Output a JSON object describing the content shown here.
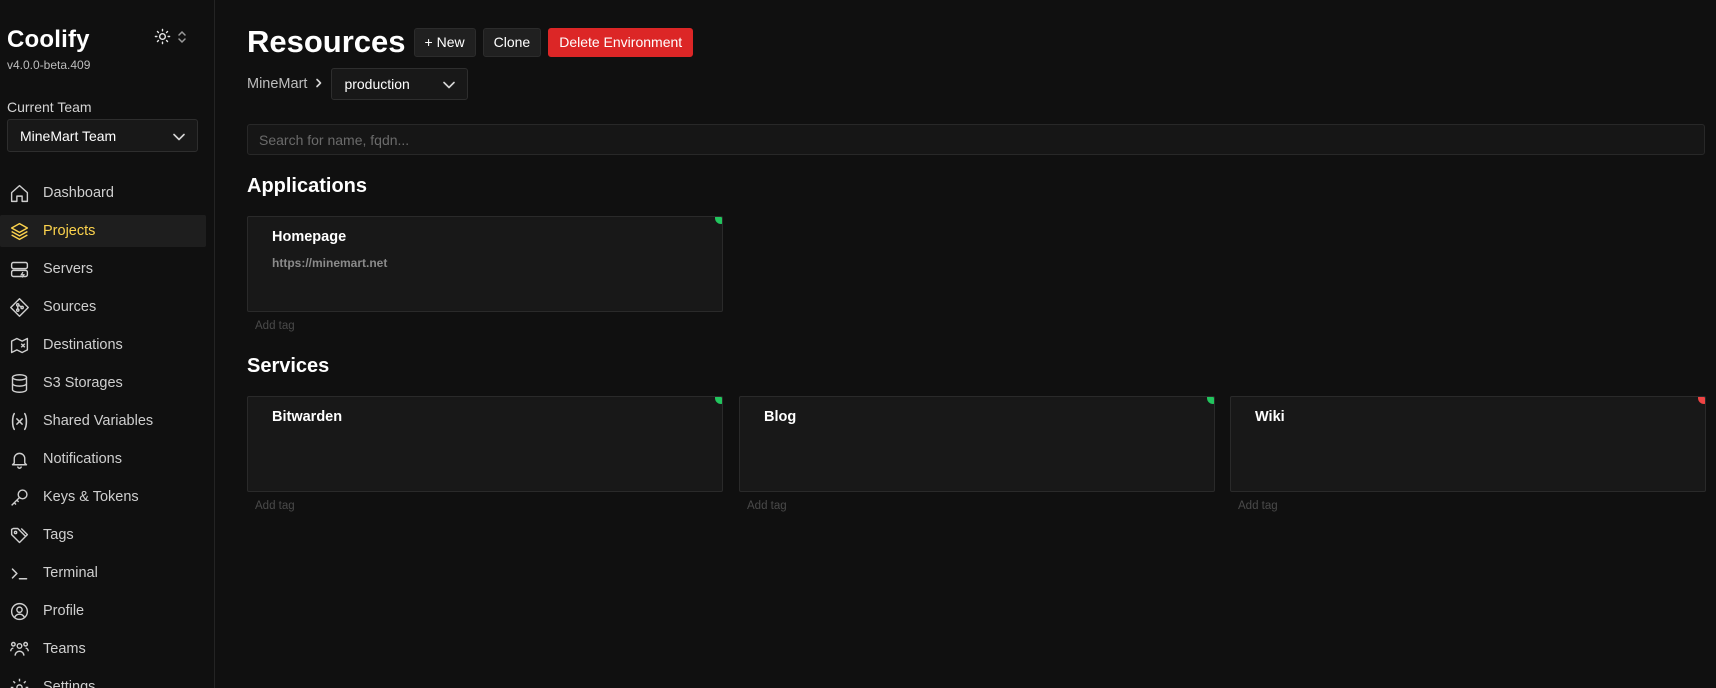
{
  "sidebar": {
    "brand": "Coolify",
    "version": "v4.0.0-beta.409",
    "team_label": "Current Team",
    "team_selected": "MineMart Team",
    "items": [
      {
        "label": "Dashboard",
        "icon": "home-icon"
      },
      {
        "label": "Projects",
        "icon": "layers-icon",
        "active": true
      },
      {
        "label": "Servers",
        "icon": "server-icon"
      },
      {
        "label": "Sources",
        "icon": "git-icon"
      },
      {
        "label": "Destinations",
        "icon": "destination-icon"
      },
      {
        "label": "S3 Storages",
        "icon": "database-icon"
      },
      {
        "label": "Shared Variables",
        "icon": "variable-icon"
      },
      {
        "label": "Notifications",
        "icon": "bell-icon"
      },
      {
        "label": "Keys & Tokens",
        "icon": "key-icon"
      },
      {
        "label": "Tags",
        "icon": "tag-icon"
      },
      {
        "label": "Terminal",
        "icon": "terminal-icon"
      },
      {
        "label": "Profile",
        "icon": "user-circle-icon"
      },
      {
        "label": "Teams",
        "icon": "users-icon"
      },
      {
        "label": "Settings",
        "icon": "gear-icon"
      }
    ]
  },
  "header": {
    "title": "Resources",
    "new_label": "+ New",
    "clone_label": "Clone",
    "delete_label": "Delete Environment"
  },
  "breadcrumb": {
    "project": "MineMart",
    "environment": "production"
  },
  "search": {
    "placeholder": "Search for name, fqdn..."
  },
  "applications": {
    "title": "Applications",
    "items": [
      {
        "name": "Homepage",
        "url": "https://minemart.net",
        "status_color": "#22c55e",
        "tag_label": "Add tag"
      }
    ]
  },
  "services": {
    "title": "Services",
    "items": [
      {
        "name": "Bitwarden",
        "status_color": "#22c55e",
        "tag_label": "Add tag"
      },
      {
        "name": "Blog",
        "status_color": "#22c55e",
        "tag_label": "Add tag"
      },
      {
        "name": "Wiki",
        "status_color": "#ef4444",
        "tag_label": "Add tag"
      }
    ]
  },
  "colors": {
    "accent": "#fcd34d",
    "danger": "#dc2626",
    "running": "#22c55e",
    "stopped": "#ef4444"
  }
}
